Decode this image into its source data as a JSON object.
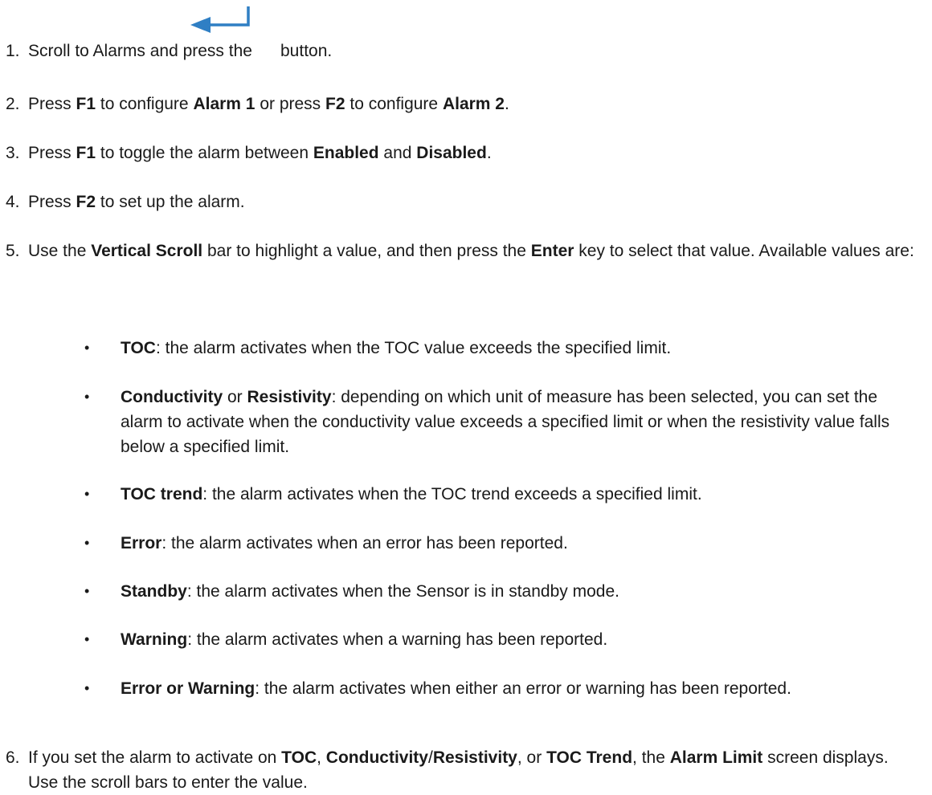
{
  "steps": [
    {
      "num": "1.",
      "parts": [
        "Scroll to Alarms and press the ",
        "button."
      ],
      "icon": "enter-arrow-icon"
    },
    {
      "num": "2.",
      "parts": [
        "Press ",
        "F1",
        " to configure ",
        "Alarm 1",
        " or press ",
        "F2",
        " to configure ",
        "Alarm 2",
        "."
      ]
    },
    {
      "num": "3.",
      "parts": [
        "Press ",
        "F1",
        " to toggle the alarm between ",
        "Enabled",
        " and ",
        "Disabled",
        "."
      ]
    },
    {
      "num": "4.",
      "parts": [
        "Press ",
        "F2",
        " to set up the alarm."
      ]
    },
    {
      "num": "5.",
      "parts": [
        "Use the ",
        "Vertical Scroll",
        " bar to highlight a value, and then press the ",
        "Enter",
        " key to select that value. Available values are:"
      ]
    },
    {
      "num": "6.",
      "parts": [
        "If you set the alarm to activate on ",
        "TOC",
        ", ",
        "Conductivity",
        "/",
        "Resistivity",
        ", or ",
        "TOC Trend",
        ", the ",
        "Alarm Limit",
        " screen displays. Use the scroll bars to enter the value."
      ]
    }
  ],
  "bullets": [
    {
      "parts": [
        "TOC",
        ": the alarm activates when the TOC value exceeds the specified limit."
      ]
    },
    {
      "parts": [
        "Conductivity",
        " or ",
        "Resistivity",
        ": depending on which unit of measure has been selected, you can set the alarm to activate when the conductivity value exceeds a specified limit or when the resistivity value falls below a specified limit."
      ]
    },
    {
      "parts": [
        "TOC trend",
        ": the alarm activates when the TOC trend exceeds a specified limit."
      ]
    },
    {
      "parts": [
        "Error",
        ": the alarm activates when an error has been reported."
      ]
    },
    {
      "parts": [
        "Standby",
        ": the alarm activates when the Sensor is in standby mode."
      ]
    },
    {
      "parts": [
        "Warning",
        ": the alarm activates when a warning has been reported."
      ]
    },
    {
      "parts": [
        "Error or Warning",
        ": the alarm activates when either an error or warning has been reported."
      ]
    }
  ],
  "bullet_glyph": "•",
  "colors": {
    "icon": "#2f7fc4",
    "text": "#1a1a1a"
  }
}
